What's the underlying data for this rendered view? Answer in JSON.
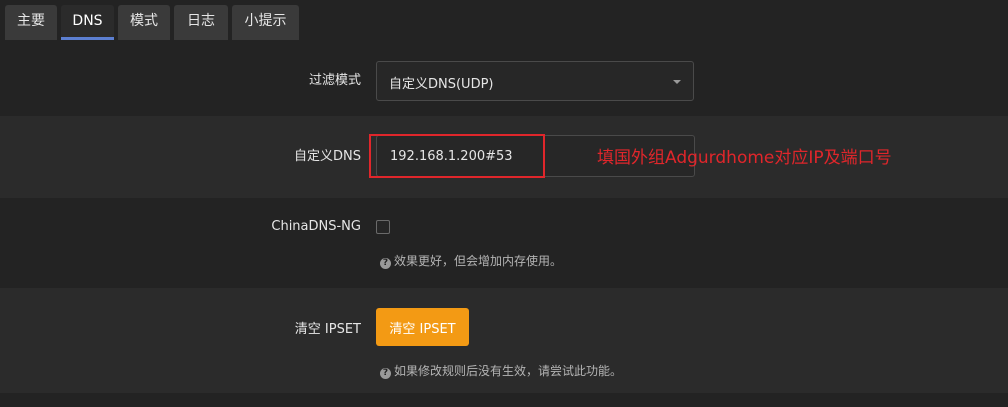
{
  "tabs": [
    {
      "label": "主要",
      "active": false
    },
    {
      "label": "DNS",
      "active": true
    },
    {
      "label": "模式",
      "active": false
    },
    {
      "label": "日志",
      "active": false
    },
    {
      "label": "小提示",
      "active": false
    }
  ],
  "filter_mode": {
    "label": "过滤模式",
    "selected": "自定义DNS(UDP)"
  },
  "custom_dns": {
    "label": "自定义DNS",
    "value": "192.168.1.200#53",
    "annotation": "填国外组Adgurdhome对应IP及端口号"
  },
  "chinadns_ng": {
    "label": "ChinaDNS-NG",
    "checked": false,
    "help": "效果更好，但会增加内存使用。"
  },
  "clear_ipset": {
    "label": "清空 IPSET",
    "button_label": "清空 IPSET",
    "help": "如果修改规则后没有生效，请尝试此功能。"
  },
  "colors": {
    "background": "#232323",
    "alt_row": "#2b2b2b",
    "accent_tab": "#5c7fd1",
    "button_orange": "#f39a14",
    "annotation_red": "#e0262b"
  },
  "icons": {
    "help": "question-circle-icon",
    "dropdown": "caret-down-icon"
  }
}
